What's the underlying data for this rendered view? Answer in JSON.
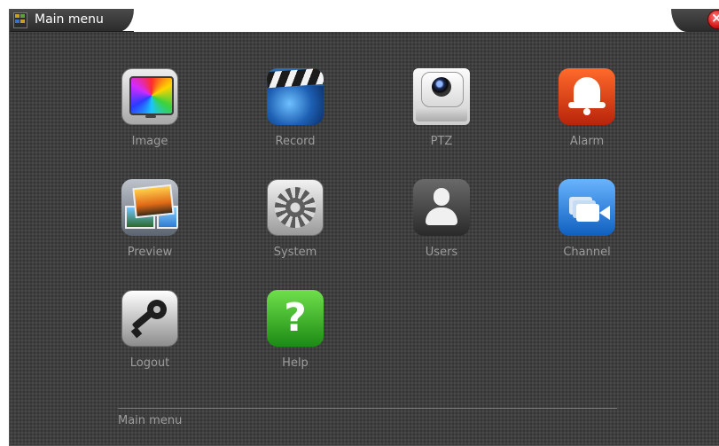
{
  "window": {
    "title": "Main menu",
    "status_text": "Main menu",
    "close_icon": "close-icon"
  },
  "menu": {
    "items": [
      {
        "label": "Image",
        "icon": "image-icon"
      },
      {
        "label": "Record",
        "icon": "record-clapperboard-icon"
      },
      {
        "label": "PTZ",
        "icon": "ptz-camera-icon"
      },
      {
        "label": "Alarm",
        "icon": "alarm-bell-icon"
      },
      {
        "label": "Preview",
        "icon": "preview-photos-icon"
      },
      {
        "label": "System",
        "icon": "system-gear-icon"
      },
      {
        "label": "Users",
        "icon": "users-person-icon"
      },
      {
        "label": "Channel",
        "icon": "channel-cameras-icon"
      },
      {
        "label": "Logout",
        "icon": "logout-key-icon"
      },
      {
        "label": "Help",
        "icon": "help-question-icon"
      }
    ],
    "help_glyph": "?"
  },
  "colors": {
    "background": "#3f3f3f",
    "label_text": "#9c9c9c",
    "title_text": "#ffffff",
    "close_button": "#d41818"
  }
}
